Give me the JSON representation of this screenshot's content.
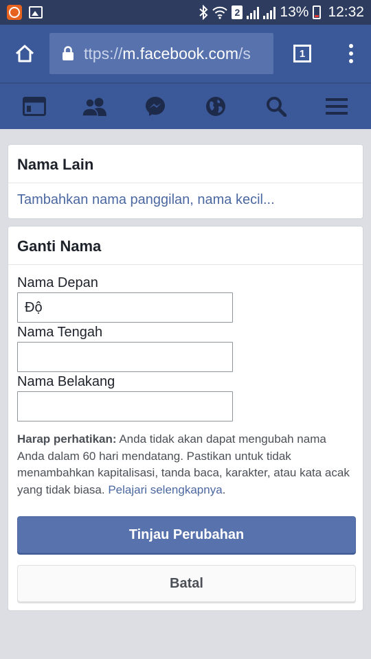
{
  "status_bar": {
    "icons_left": [
      "app-notification-icon",
      "gallery-icon"
    ],
    "icons_right": [
      "bluetooth-icon",
      "wifi-icon",
      "sim-2-icon",
      "signal-icon",
      "signal-icon",
      "battery-icon"
    ],
    "sim_label": "2",
    "battery": "13%",
    "time": "12:32"
  },
  "browser": {
    "url_prefix": "ttps://",
    "url_domain": "m.facebook.com",
    "url_suffix": "/s",
    "tab_count": "1"
  },
  "fb_nav": {
    "items": [
      "news-feed-icon",
      "friends-icon",
      "messenger-icon",
      "notifications-globe-icon",
      "search-icon",
      "menu-icon"
    ]
  },
  "other_names": {
    "title": "Nama Lain",
    "link": "Tambahkan nama panggilan, nama kecil..."
  },
  "change_name": {
    "title": "Ganti Nama",
    "first_name_label": "Nama Depan",
    "first_name_value": "Độ",
    "middle_name_label": "Nama Tengah",
    "middle_name_value": "",
    "last_name_label": "Nama Belakang",
    "last_name_value": "",
    "notice_bold": "Harap perhatikan:",
    "notice_text": " Anda tidak akan dapat mengubah nama Anda dalam 60 hari mendatang. Pastikan untuk tidak menambahkan kapitalisasi, tanda baca, karakter, atau kata acak yang tidak biasa. ",
    "notice_link": "Pelajari selengkapnya",
    "notice_end": ".",
    "review_button": "Tinjau Perubahan",
    "cancel_button": "Batal"
  },
  "colors": {
    "status_bar": "#2d3c5f",
    "facebook_blue": "#3b5998",
    "link_blue": "#4b67a1",
    "primary_button": "#5872ad"
  }
}
